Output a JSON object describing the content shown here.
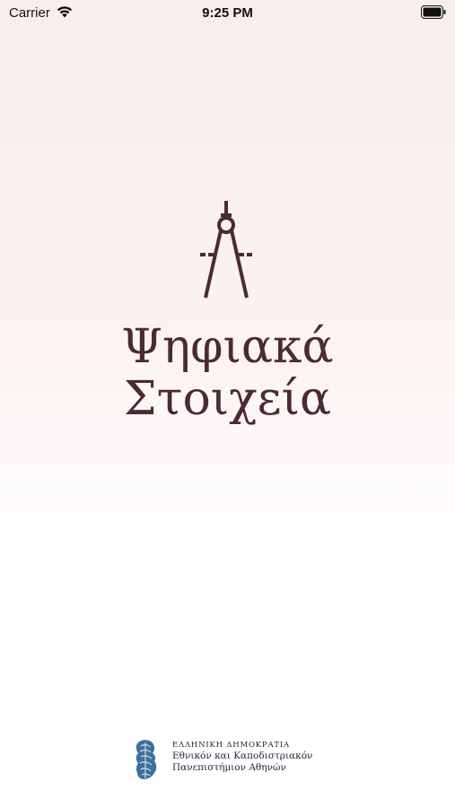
{
  "status_bar": {
    "carrier": "Carrier",
    "time": "9:25 PM",
    "icons": [
      "wifi-icon",
      "battery-icon"
    ]
  },
  "splash": {
    "logo_icon": "compass-icon",
    "title_line1": "Ψηφιακά",
    "title_line2": "Στοιχεία",
    "brand_color": "#4a2a33"
  },
  "footer": {
    "emblem_icon": "athena-emblem-icon",
    "line1": "ΕΛΛΗΝΙΚΗ ΔΗΜΟΚΡΑΤΙΑ",
    "line2": "Εθνικόν και Καποδιστριακόν",
    "line3": "Πανεπιστήμιον Αθηνών",
    "emblem_color": "#3f6f9c"
  }
}
